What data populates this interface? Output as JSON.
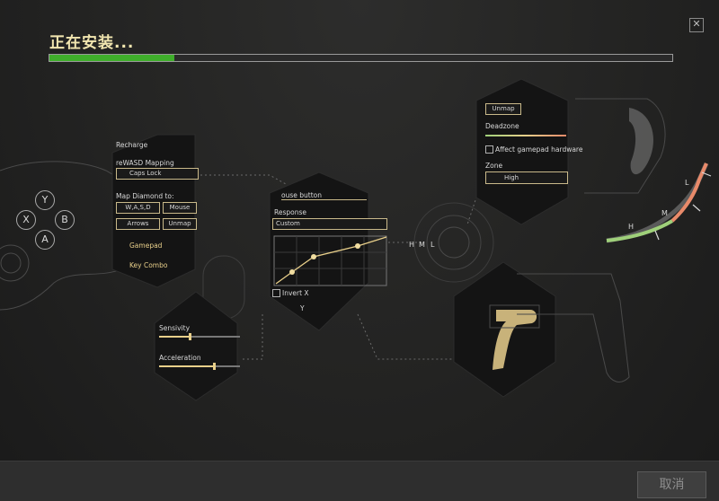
{
  "installer": {
    "title": "正在安装...",
    "progress_fraction": 0.2,
    "cancel_label": "取消",
    "close_symbol": "✕"
  },
  "colors": {
    "progress": "#3fae2b",
    "accent_gold": "#e8cf8a",
    "background": "#232322"
  },
  "illustration": {
    "gamepad_buttons": [
      "Y",
      "X",
      "B",
      "A"
    ],
    "panel_left": {
      "recharge": "Recharge",
      "mapping_label": "reWASD Mapping",
      "mapping_value": "Caps Lock",
      "map_diamond_label": "Map Diamond to:",
      "buttons": [
        "W,A,S,D",
        "Mouse",
        "Arrows",
        "Unmap"
      ],
      "gamepad": "Gamepad",
      "key_combo": "Key Combo"
    },
    "panel_sensitivity": {
      "sensivity": "Sensivity",
      "acceleration": "Acceleration"
    },
    "panel_response": {
      "header": "ouse button",
      "response_label": "Response",
      "response_value": "Custom",
      "invert_x": "Invert X",
      "invert_y": "Y"
    },
    "panel_deadzone": {
      "unmap": "Unmap",
      "deadzone": "Deadzone",
      "affect": "Affect gamepad hardware",
      "zone_label": "Zone",
      "zone_value": "High"
    },
    "stick_letters": [
      "H",
      "M",
      "L"
    ],
    "gauge_letters": [
      "L",
      "M",
      "H"
    ]
  }
}
